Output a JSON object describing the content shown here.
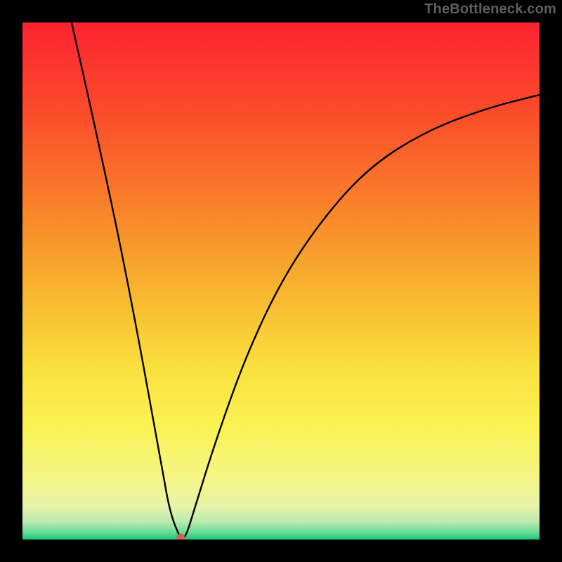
{
  "watermark": "TheBottleneck.com",
  "plot": {
    "margin": 32,
    "size": 736,
    "gradient_stops": [
      {
        "offset": 0.0,
        "color": "#fd2331"
      },
      {
        "offset": 0.18,
        "color": "#fb4d2a"
      },
      {
        "offset": 0.36,
        "color": "#f9832a"
      },
      {
        "offset": 0.52,
        "color": "#f8b52e"
      },
      {
        "offset": 0.66,
        "color": "#f9df3c"
      },
      {
        "offset": 0.78,
        "color": "#faf252"
      },
      {
        "offset": 0.88,
        "color": "#f4f584"
      },
      {
        "offset": 0.935,
        "color": "#e8f2a8"
      },
      {
        "offset": 0.965,
        "color": "#bdebb0"
      },
      {
        "offset": 0.985,
        "color": "#6ddc99"
      },
      {
        "offset": 1.0,
        "color": "#14c877"
      }
    ],
    "curve": {
      "stroke": "#000000",
      "stroke_width": 2.4
    },
    "marker": {
      "cx_rel": 0.306,
      "cy_rel": 0.997,
      "r": 6,
      "fill": "#d16055"
    }
  },
  "chart_data": {
    "type": "line",
    "title": "",
    "xlabel": "",
    "ylabel": "",
    "xlim": [
      0,
      1
    ],
    "ylim": [
      0,
      1
    ],
    "series": [
      {
        "name": "curve",
        "x": [
          0.095,
          0.14,
          0.2,
          0.27,
          0.28,
          0.29,
          0.3,
          0.306,
          0.315,
          0.33,
          0.37,
          0.43,
          0.5,
          0.58,
          0.67,
          0.78,
          0.9,
          1.0
        ],
        "y": [
          1.0,
          0.8,
          0.52,
          0.14,
          0.08,
          0.04,
          0.015,
          0.003,
          0.003,
          0.05,
          0.18,
          0.35,
          0.5,
          0.62,
          0.72,
          0.79,
          0.835,
          0.86
        ]
      }
    ],
    "annotations": [],
    "marker_point": {
      "x": 0.306,
      "y": 0.003
    },
    "note": "y=1 maps to top of plot; background is a vertical rainbow gradient from red (top) to green (bottom) inside a black frame"
  }
}
